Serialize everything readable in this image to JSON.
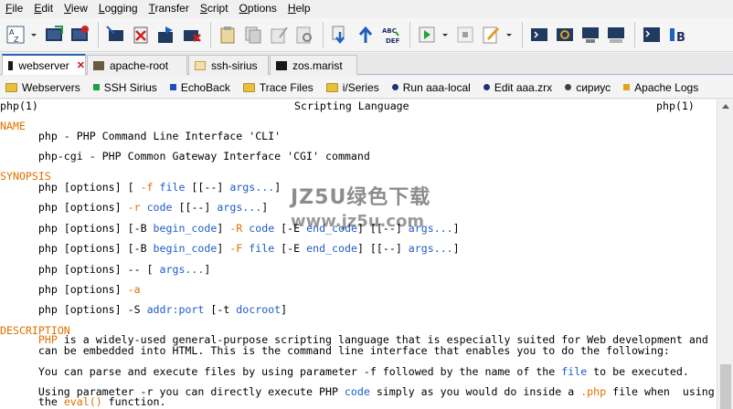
{
  "menu": [
    "File",
    "Edit",
    "View",
    "Logging",
    "Transfer",
    "Script",
    "Options",
    "Help"
  ],
  "toolbar": {
    "icons": [
      "sort-az-icon",
      "connect-icon",
      "quick-connect-icon",
      "session-new-icon",
      "session-close-icon",
      "session-copy-icon",
      "session-disconnect-icon",
      "paste-icon",
      "copy-icon",
      "edit-copy-icon",
      "find-icon",
      "download-icon",
      "upload-icon",
      "transfer-icon",
      "run-script-icon",
      "stop-icon",
      "edit-icon",
      "terminal-icon",
      "capture-icon",
      "settings-screen-icon",
      "sftp-icon",
      "tile-icon",
      "font-icon"
    ]
  },
  "tabs": [
    {
      "label": "webserver",
      "active": true,
      "color": "#1a1a1a"
    },
    {
      "label": "apache-root",
      "active": false,
      "color": "#6a5a40"
    },
    {
      "label": "ssh-sirius",
      "active": false,
      "color": "#c8a040"
    },
    {
      "label": "zos.marist",
      "active": false,
      "color": "#1a1a1a"
    }
  ],
  "tab_close": "✕",
  "bookmarks": [
    {
      "label": "Webservers",
      "kind": "folder"
    },
    {
      "label": "SSH Sirius",
      "kind": "square",
      "color": "#20a040"
    },
    {
      "label": "EchoBack",
      "kind": "square",
      "color": "#2050c0"
    },
    {
      "label": "Trace Files",
      "kind": "folder"
    },
    {
      "label": "i/Series",
      "kind": "folder"
    },
    {
      "label": "Run aaa-local",
      "kind": "dot",
      "color": "#203080"
    },
    {
      "label": "Edit aaa.zrx",
      "kind": "dot",
      "color": "#203080"
    },
    {
      "label": "сириус",
      "kind": "dot",
      "color": "#404040"
    },
    {
      "label": "Apache Logs",
      "kind": "square",
      "color": "#e0a020"
    }
  ],
  "terminal": {
    "header_left": "php(1)",
    "header_center": "Scripting Language",
    "header_right": "php(1)",
    "name_heading": "NAME",
    "name_lines": [
      "      php - PHP Command Line Interface 'CLI'",
      "      php-cgi - PHP Common Gateway Interface 'CGI' command"
    ],
    "synopsis_heading": "SYNOPSIS",
    "synopsis": [
      [
        {
          "t": "      php "
        },
        {
          "t": "[options] [ "
        },
        {
          "t": "-f",
          "c": "orange"
        },
        {
          "t": " "
        },
        {
          "t": "file",
          "c": "blue"
        },
        {
          "t": " [[--] "
        },
        {
          "t": "args...",
          "c": "blue"
        },
        {
          "t": "]"
        }
      ],
      [
        {
          "t": "      php "
        },
        {
          "t": "[options] "
        },
        {
          "t": "-r",
          "c": "orange"
        },
        {
          "t": " "
        },
        {
          "t": "code",
          "c": "blue"
        },
        {
          "t": " [[--] "
        },
        {
          "t": "args...",
          "c": "blue"
        },
        {
          "t": "]"
        }
      ],
      [
        {
          "t": "      php "
        },
        {
          "t": "[options] [-B "
        },
        {
          "t": "begin_code",
          "c": "blue"
        },
        {
          "t": "] "
        },
        {
          "t": "-R",
          "c": "orange"
        },
        {
          "t": " "
        },
        {
          "t": "code",
          "c": "blue"
        },
        {
          "t": " [-E "
        },
        {
          "t": "end_code",
          "c": "blue"
        },
        {
          "t": "] [[--] "
        },
        {
          "t": "args...",
          "c": "blue"
        },
        {
          "t": "]"
        }
      ],
      [
        {
          "t": "      php "
        },
        {
          "t": "[options] [-B "
        },
        {
          "t": "begin_code",
          "c": "blue"
        },
        {
          "t": "] "
        },
        {
          "t": "-F",
          "c": "orange"
        },
        {
          "t": " "
        },
        {
          "t": "file",
          "c": "blue"
        },
        {
          "t": " [-E "
        },
        {
          "t": "end_code",
          "c": "blue"
        },
        {
          "t": "] [[--] "
        },
        {
          "t": "args...",
          "c": "blue"
        },
        {
          "t": "]"
        }
      ],
      [
        {
          "t": "      php "
        },
        {
          "t": "[options] -- [ "
        },
        {
          "t": "args...",
          "c": "blue"
        },
        {
          "t": "]"
        }
      ],
      [
        {
          "t": "      php "
        },
        {
          "t": "[options] "
        },
        {
          "t": "-a",
          "c": "orange"
        }
      ],
      [
        {
          "t": "      php "
        },
        {
          "t": "[options] -S "
        },
        {
          "t": "addr:port",
          "c": "blue"
        },
        {
          "t": " [-t "
        },
        {
          "t": "docroot",
          "c": "blue"
        },
        {
          "t": "]"
        }
      ]
    ],
    "description_heading": "DESCRIPTION",
    "description": [
      [
        {
          "t": "      "
        },
        {
          "t": "PHP",
          "c": "orange"
        },
        {
          "t": " is a widely-used general-purpose scripting language that is especially suited for Web development and"
        }
      ],
      [
        {
          "t": "      can be embedded into HTML. This is the command line interface that enables you to do the following:"
        }
      ],
      [
        {
          "t": ""
        }
      ],
      [
        {
          "t": "      You can parse and execute files by using parameter -f followed by the name of the "
        },
        {
          "t": "file",
          "c": "blue"
        },
        {
          "t": " to be executed."
        }
      ],
      [
        {
          "t": ""
        }
      ],
      [
        {
          "t": "      Using parameter -r you can directly execute PHP "
        },
        {
          "t": "code",
          "c": "blue"
        },
        {
          "t": " simply as you would do inside a "
        },
        {
          "t": ".php",
          "c": "orange"
        },
        {
          "t": " file when  using"
        }
      ],
      [
        {
          "t": "      the "
        },
        {
          "t": "eval()",
          "c": "orange"
        },
        {
          "t": " function."
        }
      ]
    ]
  },
  "watermark": {
    "line1": "JZ5U绿色下载",
    "line2": "www.jz5u.com"
  }
}
